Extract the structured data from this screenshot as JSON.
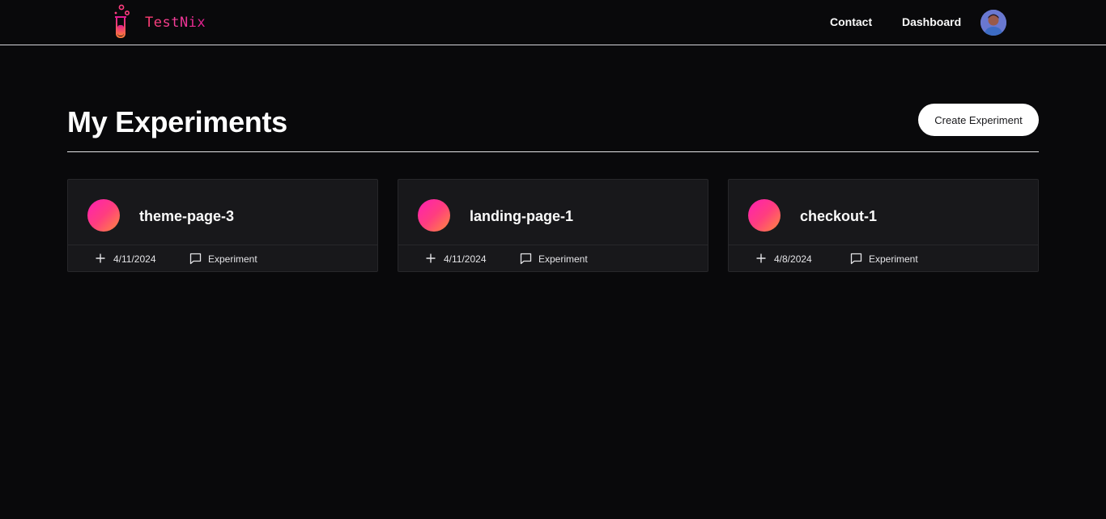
{
  "app": {
    "name": "TestNix"
  },
  "nav": {
    "links": [
      "Contact",
      "Dashboard"
    ]
  },
  "page": {
    "title": "My Experiments",
    "create_button": "Create Experiment"
  },
  "experiments": [
    {
      "name": "theme-page-3",
      "date": "4/11/2024",
      "type": "Experiment"
    },
    {
      "name": "landing-page-1",
      "date": "4/11/2024",
      "type": "Experiment"
    },
    {
      "name": "checkout-1",
      "date": "4/8/2024",
      "type": "Experiment"
    }
  ],
  "colors": {
    "background": "#09090b",
    "card": "#18181b",
    "accent_start": "#ff1fb4",
    "accent_end": "#ff8a3d"
  },
  "icons": {
    "logo": "test-tube-icon",
    "date": "plus-icon",
    "type": "message-square-icon"
  }
}
